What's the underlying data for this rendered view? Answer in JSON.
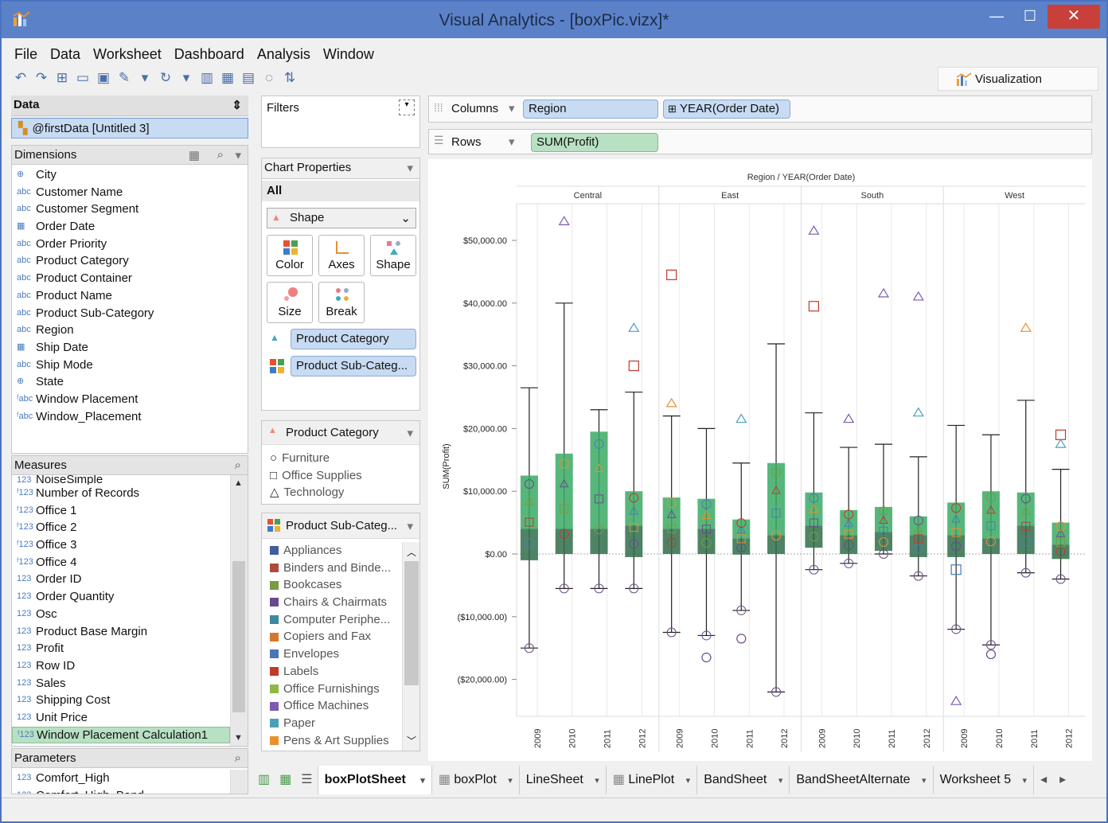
{
  "window": {
    "title": "Visual Analytics - [boxPic.vizx]*",
    "minimize": "—",
    "maximize": "☐",
    "close": "✕"
  },
  "menu": [
    "File",
    "Data",
    "Worksheet",
    "Dashboard",
    "Analysis",
    "Window"
  ],
  "viz_tab": "Visualization",
  "data_panel": {
    "header": "Data",
    "source": "@firstData [Untitled 3]"
  },
  "dimensions": {
    "header": "Dimensions",
    "items": [
      {
        "icon": "globe",
        "label": "City"
      },
      {
        "icon": "abc",
        "label": "Customer Name"
      },
      {
        "icon": "abc",
        "label": "Customer Segment"
      },
      {
        "icon": "date",
        "label": "Order Date"
      },
      {
        "icon": "abc",
        "label": "Order Priority"
      },
      {
        "icon": "abc",
        "label": "Product Category"
      },
      {
        "icon": "abc",
        "label": "Product Container"
      },
      {
        "icon": "abc",
        "label": "Product Name"
      },
      {
        "icon": "abc",
        "label": "Product Sub-Category"
      },
      {
        "icon": "abc",
        "label": "Region"
      },
      {
        "icon": "date",
        "label": "Ship Date"
      },
      {
        "icon": "abc",
        "label": "Ship Mode"
      },
      {
        "icon": "globe",
        "label": "State"
      },
      {
        "icon": "fabc",
        "label": "Window Placement"
      },
      {
        "icon": "fabc",
        "label": "Window_Placement"
      }
    ]
  },
  "measures": {
    "header": "Measures",
    "items": [
      {
        "icon": "123",
        "label": "NoiseSimple"
      },
      {
        "icon": "f123",
        "label": "Number of Records"
      },
      {
        "icon": "f123",
        "label": "Office 1"
      },
      {
        "icon": "f123",
        "label": "Office 2"
      },
      {
        "icon": "f123",
        "label": "Office 3"
      },
      {
        "icon": "f123",
        "label": "Office 4"
      },
      {
        "icon": "123",
        "label": "Order ID"
      },
      {
        "icon": "123",
        "label": "Order Quantity"
      },
      {
        "icon": "123",
        "label": "Osc"
      },
      {
        "icon": "123",
        "label": "Product Base Margin"
      },
      {
        "icon": "123",
        "label": "Profit"
      },
      {
        "icon": "123",
        "label": "Row ID"
      },
      {
        "icon": "123",
        "label": "Sales"
      },
      {
        "icon": "123",
        "label": "Shipping Cost"
      },
      {
        "icon": "123",
        "label": "Unit Price"
      },
      {
        "icon": "f123",
        "label": "Window Placement Calculation1"
      }
    ]
  },
  "parameters": {
    "header": "Parameters",
    "items": [
      {
        "icon": "123",
        "label": "Comfort_High"
      },
      {
        "icon": "123",
        "label": "Comfort_High_Band"
      }
    ]
  },
  "filters": {
    "header": "Filters"
  },
  "chart_properties": {
    "header": "Chart Properties",
    "all": "All",
    "mark_type": "Shape",
    "buttons": [
      "Color",
      "Axes",
      "Shape",
      "Size",
      "Break"
    ],
    "shape_field": "Product Category",
    "color_field": "Product Sub-Categ..."
  },
  "legend_category": {
    "header": "Product Category",
    "items": [
      {
        "shape": "○",
        "label": "Furniture"
      },
      {
        "shape": "□",
        "label": "Office Supplies"
      },
      {
        "shape": "△",
        "label": "Technology"
      }
    ]
  },
  "legend_subcategory": {
    "header": "Product Sub-Categ...",
    "items": [
      {
        "color": "#3f5f9e",
        "label": "Appliances"
      },
      {
        "color": "#b04a3a",
        "label": "Binders and Binde..."
      },
      {
        "color": "#7a9a3e",
        "label": "Bookcases"
      },
      {
        "color": "#6a4a8c",
        "label": "Chairs & Chairmats"
      },
      {
        "color": "#3a8aa0",
        "label": "Computer Periphe..."
      },
      {
        "color": "#d4782e",
        "label": "Copiers and Fax"
      },
      {
        "color": "#4a76b8",
        "label": "Envelopes"
      },
      {
        "color": "#c0392b",
        "label": "Labels"
      },
      {
        "color": "#8db848",
        "label": "Office Furnishings"
      },
      {
        "color": "#7b5ab0",
        "label": "Office Machines"
      },
      {
        "color": "#4aa0b8",
        "label": "Paper"
      },
      {
        "color": "#e8902e",
        "label": "Pens & Art Supplies"
      }
    ]
  },
  "shelves": {
    "columns_label": "Columns",
    "columns_pills": [
      "Region",
      "YEAR(Order Date)"
    ],
    "rows_label": "Rows",
    "rows_pills": [
      "SUM(Profit)"
    ]
  },
  "sheet_tabs": [
    "boxPlotSheet",
    "boxPlot",
    "LineSheet",
    "LinePlot",
    "BandSheet",
    "BandSheetAlternate",
    "Worksheet 5"
  ],
  "chart_data": {
    "type": "box",
    "title": "Region / YEAR(Order Date)",
    "ylabel": "SUM(Profit)",
    "ylim": [
      -23000,
      56000
    ],
    "yticks": [
      50000,
      40000,
      30000,
      20000,
      10000,
      0,
      -10000,
      -20000
    ],
    "ytick_labels": [
      "$50,000.00",
      "$40,000.00",
      "$30,000.00",
      "$20,000.00",
      "$10,000.00",
      "$0.00",
      "($10,000.00)",
      "($20,000.00)"
    ],
    "panels": [
      "Central",
      "East",
      "South",
      "West"
    ],
    "years": [
      "2009",
      "2010",
      "2011",
      "2012"
    ],
    "boxes": [
      {
        "panel": "Central",
        "year": "2009",
        "q1": -1000,
        "median": 4000,
        "q3": 12500,
        "whisker_low": -15000,
        "whisker_high": 26500
      },
      {
        "panel": "Central",
        "year": "2010",
        "q1": 0,
        "median": 4000,
        "q3": 16000,
        "whisker_low": -5500,
        "whisker_high": 40000
      },
      {
        "panel": "Central",
        "year": "2011",
        "q1": 0,
        "median": 4000,
        "q3": 19500,
        "whisker_low": -5500,
        "whisker_high": 23000
      },
      {
        "panel": "Central",
        "year": "2012",
        "q1": -500,
        "median": 4500,
        "q3": 10000,
        "whisker_low": -5500,
        "whisker_high": 25800
      },
      {
        "panel": "East",
        "year": "2009",
        "q1": 0,
        "median": 4000,
        "q3": 9000,
        "whisker_low": -12500,
        "whisker_high": 22000
      },
      {
        "panel": "East",
        "year": "2010",
        "q1": 0,
        "median": 4000,
        "q3": 8800,
        "whisker_low": -13000,
        "whisker_high": 20000
      },
      {
        "panel": "East",
        "year": "2011",
        "q1": -100,
        "median": 2500,
        "q3": 5500,
        "whisker_low": -9000,
        "whisker_high": 14500
      },
      {
        "panel": "East",
        "year": "2012",
        "q1": 0,
        "median": 3000,
        "q3": 14500,
        "whisker_low": -22000,
        "whisker_high": 33500
      },
      {
        "panel": "South",
        "year": "2009",
        "q1": 1000,
        "median": 4500,
        "q3": 9800,
        "whisker_low": -2500,
        "whisker_high": 22500
      },
      {
        "panel": "South",
        "year": "2010",
        "q1": 0,
        "median": 3000,
        "q3": 7000,
        "whisker_low": -1500,
        "whisker_high": 17000
      },
      {
        "panel": "South",
        "year": "2011",
        "q1": 500,
        "median": 3500,
        "q3": 7500,
        "whisker_low": 0,
        "whisker_high": 17500
      },
      {
        "panel": "South",
        "year": "2012",
        "q1": -500,
        "median": 3000,
        "q3": 6000,
        "whisker_low": -3500,
        "whisker_high": 15500
      },
      {
        "panel": "West",
        "year": "2009",
        "q1": -500,
        "median": 3000,
        "q3": 8200,
        "whisker_low": -12000,
        "whisker_high": 20500
      },
      {
        "panel": "West",
        "year": "2010",
        "q1": 0,
        "median": 2500,
        "q3": 10000,
        "whisker_low": -14500,
        "whisker_high": 19000
      },
      {
        "panel": "West",
        "year": "2011",
        "q1": 0,
        "median": 4500,
        "q3": 9800,
        "whisker_low": -3000,
        "whisker_high": 24500
      },
      {
        "panel": "West",
        "year": "2012",
        "q1": -800,
        "median": 1500,
        "q3": 5000,
        "whisker_low": -4000,
        "whisker_high": 13500
      }
    ],
    "outliers": [
      {
        "panel": "Central",
        "year": "2010",
        "shape": "triangle",
        "value": 53000,
        "color": "#7b5ab0"
      },
      {
        "panel": "Central",
        "year": "2012",
        "shape": "triangle",
        "value": 36000,
        "color": "#4a9ad4"
      },
      {
        "panel": "Central",
        "year": "2012",
        "shape": "square",
        "value": 30000,
        "color": "#c0392b"
      },
      {
        "panel": "East",
        "year": "2009",
        "shape": "square",
        "value": 44500,
        "color": "#c0392b"
      },
      {
        "panel": "East",
        "year": "2009",
        "shape": "triangle",
        "value": 24000,
        "color": "#e8902e"
      },
      {
        "panel": "East",
        "year": "2010",
        "shape": "circle",
        "value": -16500,
        "color": "#6a4a8c"
      },
      {
        "panel": "East",
        "year": "2011",
        "shape": "circle",
        "value": -13500,
        "color": "#6a4a8c"
      },
      {
        "panel": "East",
        "year": "2011",
        "shape": "triangle",
        "value": 21500,
        "color": "#4aa0b8"
      },
      {
        "panel": "South",
        "year": "2009",
        "shape": "triangle",
        "value": 51500,
        "color": "#7b5ab0"
      },
      {
        "panel": "South",
        "year": "2009",
        "shape": "square",
        "value": 39500,
        "color": "#c0392b"
      },
      {
        "panel": "South",
        "year": "2010",
        "shape": "triangle",
        "value": 21500,
        "color": "#7b5ab0"
      },
      {
        "panel": "South",
        "year": "2011",
        "shape": "triangle",
        "value": 41500,
        "color": "#7b5ab0"
      },
      {
        "panel": "South",
        "year": "2012",
        "shape": "triangle",
        "value": 41000,
        "color": "#7b5ab0"
      },
      {
        "panel": "South",
        "year": "2012",
        "shape": "triangle",
        "value": 22500,
        "color": "#4aa0b8"
      },
      {
        "panel": "West",
        "year": "2009",
        "shape": "triangle",
        "value": -23500,
        "color": "#7b5ab0"
      },
      {
        "panel": "West",
        "year": "2009",
        "shape": "square",
        "value": -2500,
        "color": "#4a76b8"
      },
      {
        "panel": "West",
        "year": "2010",
        "shape": "circle",
        "value": -16000,
        "color": "#6a4a8c"
      },
      {
        "panel": "West",
        "year": "2011",
        "shape": "triangle",
        "value": 36000,
        "color": "#e8902e"
      },
      {
        "panel": "West",
        "year": "2012",
        "shape": "square",
        "value": 19000,
        "color": "#c0392b"
      },
      {
        "panel": "West",
        "year": "2012",
        "shape": "triangle",
        "value": 17500,
        "color": "#4aa0b8"
      }
    ],
    "box_color": "#3aaa64",
    "median_band_color": "#2f6e4a",
    "legend": "Product Category shape, Product Sub-Category color"
  }
}
